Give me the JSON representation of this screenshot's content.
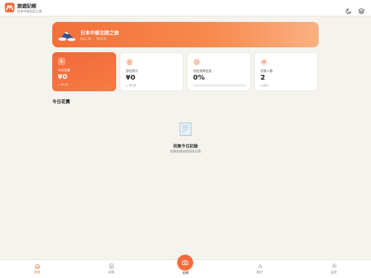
{
  "header": {
    "app_title": "旅遊記帳",
    "trip_subtitle": "日本中部北陸之旅",
    "logo_icon": "mountain-logo",
    "theme_icon": "moon-icon",
    "layers_icon": "layers-icon"
  },
  "banner": {
    "title": "日本中部北陸之旅",
    "meta": "Day 25 ・ 共25天",
    "illustration": "mount-fuji"
  },
  "stats": [
    {
      "label": "今日花費",
      "value": "¥0",
      "sub": "≈ NT$0",
      "icon": "dollar-icon"
    },
    {
      "label": "旅程累計",
      "value": "¥0",
      "sub": "≈ NT$0",
      "icon": "receipt-icon"
    },
    {
      "label": "現金預算進度",
      "value": "0%",
      "progress": 0,
      "icon": "clock-icon"
    },
    {
      "label": "記帳人數",
      "value": "2",
      "sub": "人同行",
      "icon": "users-icon"
    }
  ],
  "today": {
    "section_title": "今日花費",
    "empty_title": "尚無今日記錄",
    "empty_hint": "點擊拍攝收據開始記帳"
  },
  "nav": {
    "items": [
      {
        "label": "首頁",
        "icon": "home-icon"
      },
      {
        "label": "記帳",
        "icon": "document-icon"
      },
      {
        "label": "拍攝",
        "icon": "camera-icon"
      },
      {
        "label": "統計",
        "icon": "bar-chart-icon"
      },
      {
        "label": "設定",
        "icon": "gear-icon"
      }
    ]
  },
  "colors": {
    "accent": "#f26b3a",
    "background": "#f5f3ee"
  }
}
